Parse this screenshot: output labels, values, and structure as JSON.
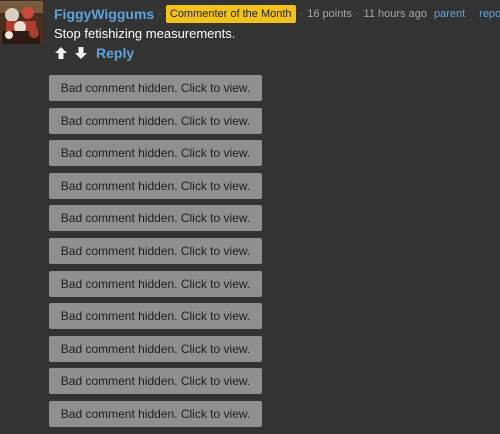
{
  "comment": {
    "author": "FiggyWiggums",
    "badge": "Commenter of the Month",
    "points": "16 points",
    "time": "11 hours ago",
    "parent_label": "parent",
    "report_label": "report",
    "text": "Stop fetishizing measurements.",
    "reply_label": "Reply",
    "separator": "·",
    "colors": {
      "link": "#5fa2dd",
      "badge": "#f2c21b",
      "background": "#333333",
      "hidden_button": "#8f8f8f"
    },
    "icons": {
      "avatar": "avatar-image",
      "upvote": "arrow-up-icon",
      "downvote": "arrow-down-icon"
    }
  },
  "hidden_comments": [
    {
      "label": "Bad comment hidden. Click to view."
    },
    {
      "label": "Bad comment hidden. Click to view."
    },
    {
      "label": "Bad comment hidden. Click to view."
    },
    {
      "label": "Bad comment hidden. Click to view."
    },
    {
      "label": "Bad comment hidden. Click to view."
    },
    {
      "label": "Bad comment hidden. Click to view."
    },
    {
      "label": "Bad comment hidden. Click to view."
    },
    {
      "label": "Bad comment hidden. Click to view."
    },
    {
      "label": "Bad comment hidden. Click to view."
    },
    {
      "label": "Bad comment hidden. Click to view."
    },
    {
      "label": "Bad comment hidden. Click to view."
    }
  ]
}
